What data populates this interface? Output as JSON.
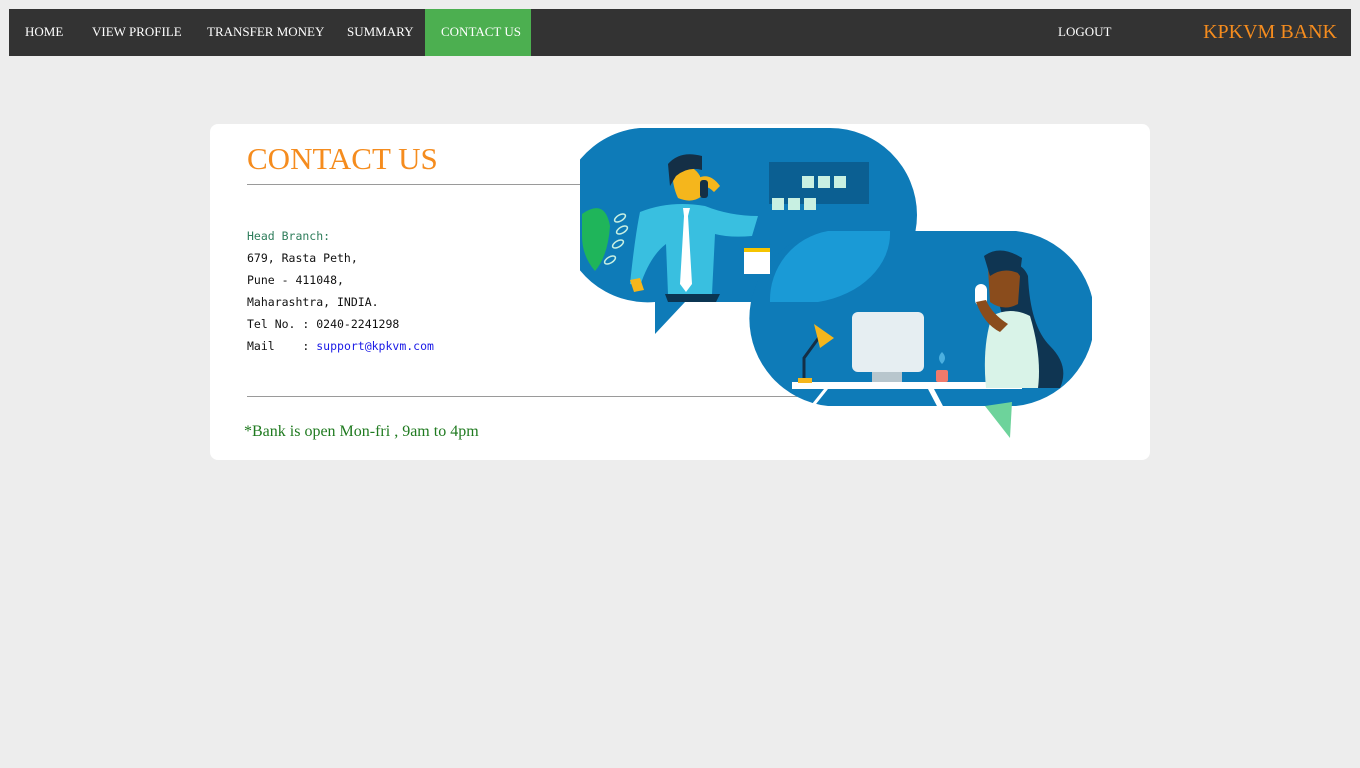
{
  "nav": {
    "home": "HOME",
    "view_profile": "VIEW PROFILE",
    "transfer_money": "TRANSFER MONEY",
    "summary": "SUMMARY",
    "contact_us": "CONTACT US",
    "logout": "LOGOUT",
    "brand": "KPKVM BANK"
  },
  "contact": {
    "title": "CONTACT US",
    "head_label": "Head Branch:",
    "address_line1": "679, Rasta Peth,",
    "address_line2": "Pune - 411048,",
    "address_line3": "Maharashtra, INDIA.",
    "tel": "Tel No. : 0240-2241298",
    "mail_label": "Mail    : ",
    "mail_value": "support@kpkvm.com",
    "note": "*Bank is open Mon-fri , 9am to 4pm"
  },
  "colors": {
    "navbar_bg": "#333333",
    "active_tab": "#4caf50",
    "brand": "#f58c1e",
    "note": "#1f7a1f",
    "link": "#1a1ae6"
  },
  "icons": {
    "illustration": "contact-illustration"
  }
}
